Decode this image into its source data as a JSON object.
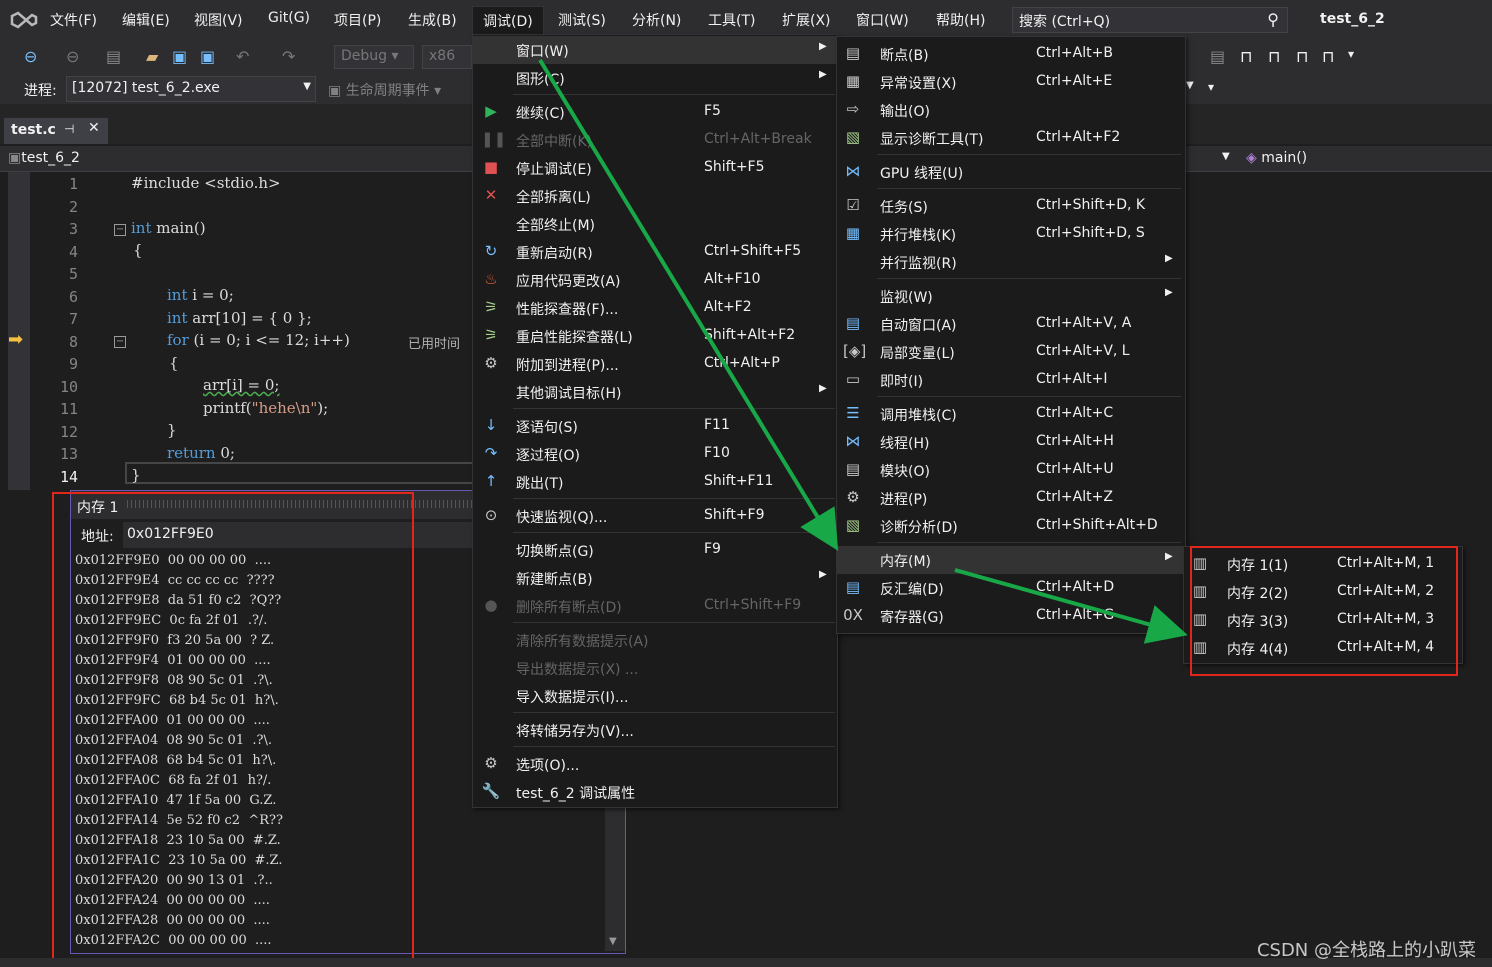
{
  "menubar": {
    "items": [
      "文件(F)",
      "编辑(E)",
      "视图(V)",
      "Git(G)",
      "项目(P)",
      "生成(B)",
      "调试(D)",
      "测试(S)",
      "分析(N)",
      "工具(T)",
      "扩展(X)",
      "窗口(W)",
      "帮助(H)"
    ],
    "search_placeholder": "搜索 (Ctrl+Q)",
    "app_title": "test_6_2"
  },
  "toolbar": {
    "config": "Debug",
    "platform": "x86",
    "process_label": "进程:",
    "process_value": "[12072] test_6_2.exe",
    "lifecycle": "生命周期事件"
  },
  "tab": {
    "file": "test.c"
  },
  "navbar": {
    "project": "test_6_2",
    "function": "main()"
  },
  "editor": {
    "line_numbers": [
      "1",
      "2",
      "3",
      "4",
      "5",
      "6",
      "7",
      "8",
      "9",
      "10",
      "11",
      "12",
      "13",
      "14"
    ],
    "lines": {
      "l1": "#include <stdio.h>",
      "l3a": "int",
      "l3b": " main()",
      "l4": "{",
      "l6a": "int",
      "l6b": " i = 0;",
      "l7a": "int",
      "l7b": " arr[10] = { 0 };",
      "l8a": "for",
      "l8b": " (i = 0; i <= 12; i++)",
      "l8c": "已用时间",
      "l9": "{",
      "l10": "arr[i] = 0;",
      "l11a": "printf(",
      "l11b": "\"hehe\\n\"",
      "l11c": ");",
      "l12": "}",
      "l13a": "return",
      "l13b": " 0;",
      "l14": "}"
    }
  },
  "memory": {
    "title": "内存 1",
    "addr_label": "地址:",
    "addr_value": "0x012FF9E0",
    "rows": [
      "0x012FF9E0  00 00 00 00  ....",
      "0x012FF9E4  cc cc cc cc  ????",
      "0x012FF9E8  da 51 f0 c2  ?Q??",
      "0x012FF9EC  0c fa 2f 01  .?/.",
      "0x012FF9F0  f3 20 5a 00  ? Z.",
      "0x012FF9F4  01 00 00 00  ....",
      "0x012FF9F8  08 90 5c 01  .?\\.",
      "0x012FF9FC  68 b4 5c 01  h?\\.",
      "0x012FFA00  01 00 00 00  ....",
      "0x012FFA04  08 90 5c 01  .?\\.",
      "0x012FFA08  68 b4 5c 01  h?\\.",
      "0x012FFA0C  68 fa 2f 01  h?/.",
      "0x012FFA10  47 1f 5a 00  G.Z.",
      "0x012FFA14  5e 52 f0 c2  ^R??",
      "0x012FFA18  23 10 5a 00  #.Z.",
      "0x012FFA1C  23 10 5a 00  #.Z.",
      "0x012FFA20  00 90 13 01  .?..",
      "0x012FFA24  00 00 00 00  ....",
      "0x012FFA28  00 00 00 00  ....",
      "0x012FFA2C  00 00 00 00  ...."
    ]
  },
  "debug_menu": [
    {
      "label": "窗口(W)",
      "shortcut": "",
      "submenu": true,
      "highlighted": true,
      "icon": ""
    },
    {
      "label": "图形(C)",
      "shortcut": "",
      "submenu": true,
      "icon": ""
    },
    {
      "label": "继续(C)",
      "shortcut": "F5",
      "icon": "play-icon"
    },
    {
      "label": "全部中断(K)",
      "shortcut": "Ctrl+Alt+Break",
      "disabled": true,
      "icon": "pause-icon"
    },
    {
      "label": "停止调试(E)",
      "shortcut": "Shift+F5",
      "icon": "stop-icon"
    },
    {
      "label": "全部拆离(L)",
      "shortcut": "",
      "icon": "detach-icon"
    },
    {
      "label": "全部终止(M)",
      "shortcut": "",
      "icon": ""
    },
    {
      "label": "重新启动(R)",
      "shortcut": "Ctrl+Shift+F5",
      "icon": "restart-icon"
    },
    {
      "label": "应用代码更改(A)",
      "shortcut": "Alt+F10",
      "icon": "hot-reload-icon"
    },
    {
      "label": "性能探查器(F)...",
      "shortcut": "Alt+F2",
      "icon": "profiler-icon"
    },
    {
      "label": "重启性能探查器(L)",
      "shortcut": "Shift+Alt+F2",
      "icon": "profiler-restart-icon"
    },
    {
      "label": "附加到进程(P)...",
      "shortcut": "Ctrl+Alt+P",
      "icon": "attach-icon"
    },
    {
      "label": "其他调试目标(H)",
      "shortcut": "",
      "submenu": true,
      "icon": ""
    },
    {
      "label": "逐语句(S)",
      "shortcut": "F11",
      "icon": "step-into-icon"
    },
    {
      "label": "逐过程(O)",
      "shortcut": "F10",
      "icon": "step-over-icon"
    },
    {
      "label": "跳出(T)",
      "shortcut": "Shift+F11",
      "icon": "step-out-icon"
    },
    {
      "label": "快速监视(Q)...",
      "shortcut": "Shift+F9",
      "icon": "quickwatch-icon"
    },
    {
      "label": "切换断点(G)",
      "shortcut": "F9",
      "icon": ""
    },
    {
      "label": "新建断点(B)",
      "shortcut": "",
      "submenu": true,
      "icon": ""
    },
    {
      "label": "删除所有断点(D)",
      "shortcut": "Ctrl+Shift+F9",
      "disabled": true,
      "icon": "delete-breakpoints-icon"
    },
    {
      "label": "清除所有数据提示(A)",
      "shortcut": "",
      "disabled": true,
      "icon": ""
    },
    {
      "label": "导出数据提示(X) ...",
      "shortcut": "",
      "disabled": true,
      "icon": ""
    },
    {
      "label": "导入数据提示(I)...",
      "shortcut": "",
      "icon": ""
    },
    {
      "label": "将转储另存为(V)...",
      "shortcut": "",
      "icon": ""
    },
    {
      "label": "选项(O)...",
      "shortcut": "",
      "icon": "gear-icon"
    },
    {
      "label": "test_6_2 调试属性",
      "shortcut": "",
      "icon": "wrench-icon"
    }
  ],
  "window_menu": [
    {
      "label": "断点(B)",
      "shortcut": "Ctrl+Alt+B",
      "icon": "breakpoints-icon"
    },
    {
      "label": "异常设置(X)",
      "shortcut": "Ctrl+Alt+E",
      "icon": "exception-icon"
    },
    {
      "label": "输出(O)",
      "shortcut": "",
      "icon": "output-icon"
    },
    {
      "label": "显示诊断工具(T)",
      "shortcut": "Ctrl+Alt+F2",
      "icon": "diagnostics-icon"
    },
    {
      "label": "GPU 线程(U)",
      "shortcut": "",
      "icon": "gpu-threads-icon"
    },
    {
      "label": "任务(S)",
      "shortcut": "Ctrl+Shift+D, K",
      "icon": "tasks-icon"
    },
    {
      "label": "并行堆栈(K)",
      "shortcut": "Ctrl+Shift+D, S",
      "icon": "parallel-stacks-icon"
    },
    {
      "label": "并行监视(R)",
      "shortcut": "",
      "submenu": true,
      "icon": ""
    },
    {
      "label": "监视(W)",
      "shortcut": "",
      "submenu": true,
      "icon": ""
    },
    {
      "label": "自动窗口(A)",
      "shortcut": "Ctrl+Alt+V, A",
      "icon": "autos-icon"
    },
    {
      "label": "局部变量(L)",
      "shortcut": "Ctrl+Alt+V, L",
      "icon": "locals-icon"
    },
    {
      "label": "即时(I)",
      "shortcut": "Ctrl+Alt+I",
      "icon": "immediate-icon"
    },
    {
      "label": "调用堆栈(C)",
      "shortcut": "Ctrl+Alt+C",
      "icon": "callstack-icon"
    },
    {
      "label": "线程(H)",
      "shortcut": "Ctrl+Alt+H",
      "icon": "threads-icon"
    },
    {
      "label": "模块(O)",
      "shortcut": "Ctrl+Alt+U",
      "icon": "modules-icon"
    },
    {
      "label": "进程(P)",
      "shortcut": "Ctrl+Alt+Z",
      "icon": "processes-icon"
    },
    {
      "label": "诊断分析(D)",
      "shortcut": "Ctrl+Shift+Alt+D",
      "icon": "diag-analysis-icon"
    },
    {
      "label": "内存(M)",
      "shortcut": "",
      "submenu": true,
      "highlighted": true,
      "icon": ""
    },
    {
      "label": "反汇编(D)",
      "shortcut": "Ctrl+Alt+D",
      "icon": "disassembly-icon"
    },
    {
      "label": "寄存器(G)",
      "shortcut": "Ctrl+Alt+G",
      "icon": "registers-icon"
    }
  ],
  "memory_menu": [
    {
      "label": "内存 1(1)",
      "shortcut": "Ctrl+Alt+M, 1",
      "icon": "memory-icon"
    },
    {
      "label": "内存 2(2)",
      "shortcut": "Ctrl+Alt+M, 2",
      "icon": "memory-icon"
    },
    {
      "label": "内存 3(3)",
      "shortcut": "Ctrl+Alt+M, 3",
      "icon": "memory-icon"
    },
    {
      "label": "内存 4(4)",
      "shortcut": "Ctrl+Alt+M, 4",
      "icon": "memory-icon"
    }
  ],
  "watermark": "CSDN @全栈路上的小趴菜",
  "colors": {
    "annotation_red": "#e1261c",
    "annotation_green": "#18a848",
    "keyword": "#569cd6"
  }
}
